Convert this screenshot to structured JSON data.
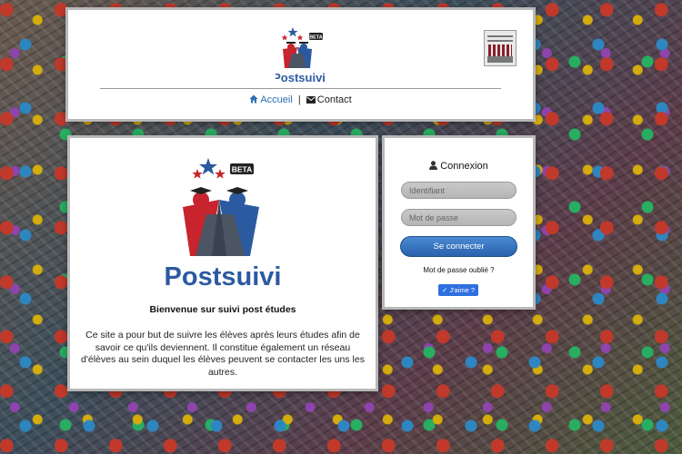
{
  "header": {
    "logo_text": "Postsuivi",
    "logo_badge": "BETA",
    "nav": {
      "home_label": "Accueil",
      "separator": "|",
      "contact_label": "Contact"
    }
  },
  "main": {
    "logo_text": "Postsuivi",
    "logo_badge": "BETA",
    "welcome": "Bienvenue sur suivi post études",
    "description": "Ce site a pour but de suivre les élèves après leurs études afin de savoir ce qu'ils deviennent. Il constitue également un réseau d'élèves au sein duquel les élèves peuvent se contacter les uns les autres."
  },
  "login": {
    "title": "Connexion",
    "username_placeholder": "Identifiant",
    "password_placeholder": "Mot de passe",
    "submit_label": "Se connecter",
    "forgot_label": "Mot de passe oublié ?",
    "like_label": "J'aime ?"
  },
  "colors": {
    "brand_blue": "#2c5aa0",
    "brand_red": "#c8242e",
    "link": "#2a6fb0",
    "button": "#2a62ad"
  },
  "icons": [
    "home-icon",
    "envelope-icon",
    "user-icon",
    "check-icon"
  ]
}
